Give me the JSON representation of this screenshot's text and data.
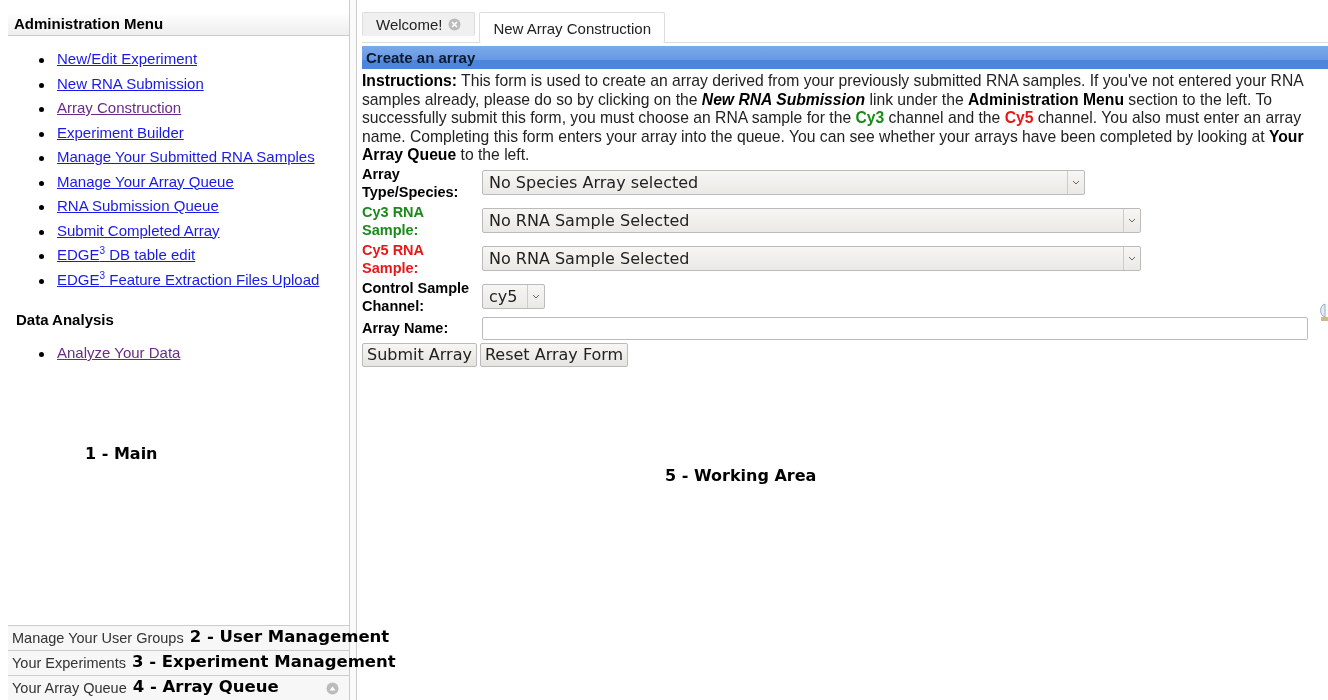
{
  "sidebar": {
    "title": "Administration Menu",
    "admin_links": [
      {
        "label": "New/Edit Experiment",
        "visited": false
      },
      {
        "label": "New RNA Submission",
        "visited": false
      },
      {
        "label": "Array Construction",
        "visited": true
      },
      {
        "label": "Experiment Builder",
        "visited": false
      },
      {
        "label": "Manage Your Submitted RNA Samples",
        "visited": false
      },
      {
        "label": "Manage Your Array Queue",
        "visited": false
      },
      {
        "label": "RNA Submission Queue",
        "visited": false
      },
      {
        "label": "Submit Completed Array",
        "visited": false
      },
      {
        "label": "EDGE$^{3}$ DB table edit",
        "visited": false
      },
      {
        "label": "EDGE$^{3}$ Feature Extraction Files Upload",
        "visited": false
      }
    ],
    "analysis_title": "Data Analysis",
    "analysis_links": [
      {
        "label": "Analyze Your Data",
        "visited": true
      }
    ],
    "annotation": "1 - Main",
    "sections": [
      {
        "label": "Manage Your User Groups",
        "annotation": "2 - User Management",
        "kind": "plain"
      },
      {
        "label": "Your Experiments",
        "annotation": "3 - Experiment Management",
        "kind": "plain"
      },
      {
        "label": "Your Array Queue",
        "annotation": "4 - Array Queue",
        "kind": "toggle"
      }
    ]
  },
  "tabs": [
    {
      "label": "Welcome!",
      "closable": true,
      "selected": false
    },
    {
      "label": "New Array Construction",
      "closable": false,
      "selected": true
    }
  ],
  "panel": {
    "title": "Create an array",
    "instructions": [
      {
        "kind": "bold",
        "text": "Instructions:"
      },
      {
        "kind": "plain",
        "text": " This form is used to create an array derived from your previously submitted RNA samples. If you've not entered your RNA samples already, please do so by clicking on the "
      },
      {
        "kind": "emphasis",
        "text": "New RNA Submission"
      },
      {
        "kind": "plain",
        "text": " link under the "
      },
      {
        "kind": "bold",
        "text": "Administration Menu"
      },
      {
        "kind": "plain",
        "text": " section to the left. To successfully submit this form, you must choose an RNA sample for the "
      },
      {
        "kind": "cy3",
        "text": "Cy3"
      },
      {
        "kind": "plain",
        "text": " channel and the "
      },
      {
        "kind": "cy5",
        "text": "Cy5"
      },
      {
        "kind": "plain",
        "text": " channel. You also must enter an array name. Completing this form enters your array into the queue. You can see whether your arrays have been completed by looking at "
      },
      {
        "kind": "bold",
        "text": "Your Array Queue"
      },
      {
        "kind": "plain",
        "text": " to the left."
      }
    ],
    "fields": [
      {
        "label": "Array Type/Species:",
        "color": "#000000",
        "kind": "select",
        "value": "No Species Array selected"
      },
      {
        "label": "Cy3 RNA Sample:",
        "color": "#1a8a1a",
        "kind": "select",
        "value": "No RNA Sample Selected"
      },
      {
        "label": "Cy5 RNA Sample:",
        "color": "#e81818",
        "kind": "select",
        "value": "No RNA Sample Selected"
      },
      {
        "label": "Control Sample Channel:",
        "color": "#000000",
        "kind": "select",
        "value": "cy5"
      },
      {
        "label": "Array Name:",
        "color": "#000000",
        "kind": "text"
      }
    ],
    "buttons": [
      "Submit Array",
      "Reset Array Form"
    ],
    "annotation": "5 - Working Area"
  }
}
